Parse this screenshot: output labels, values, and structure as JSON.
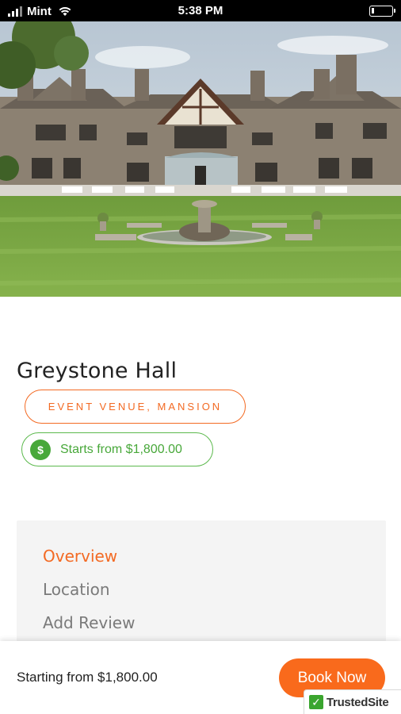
{
  "status_bar": {
    "carrier": "Mint",
    "time": "5:38 PM"
  },
  "hero": {
    "image": "mansion-exterior-photo"
  },
  "venue": {
    "title": "Greystone Hall",
    "categories": "EVENT VENUE, MANSION",
    "price_label": "Starts from $1,800.00",
    "price_icon": "$"
  },
  "tabs": {
    "overview": "Overview",
    "location": "Location",
    "add_review": "Add Review"
  },
  "bottom_bar": {
    "price": "Starting from $1,800.00",
    "book_label": "Book Now"
  },
  "trusted_badge": {
    "check": "✓",
    "label": "TrustedSite"
  },
  "colors": {
    "accent": "#f36a23",
    "price_green": "#48a83a",
    "book_button": "#f96a1c"
  }
}
